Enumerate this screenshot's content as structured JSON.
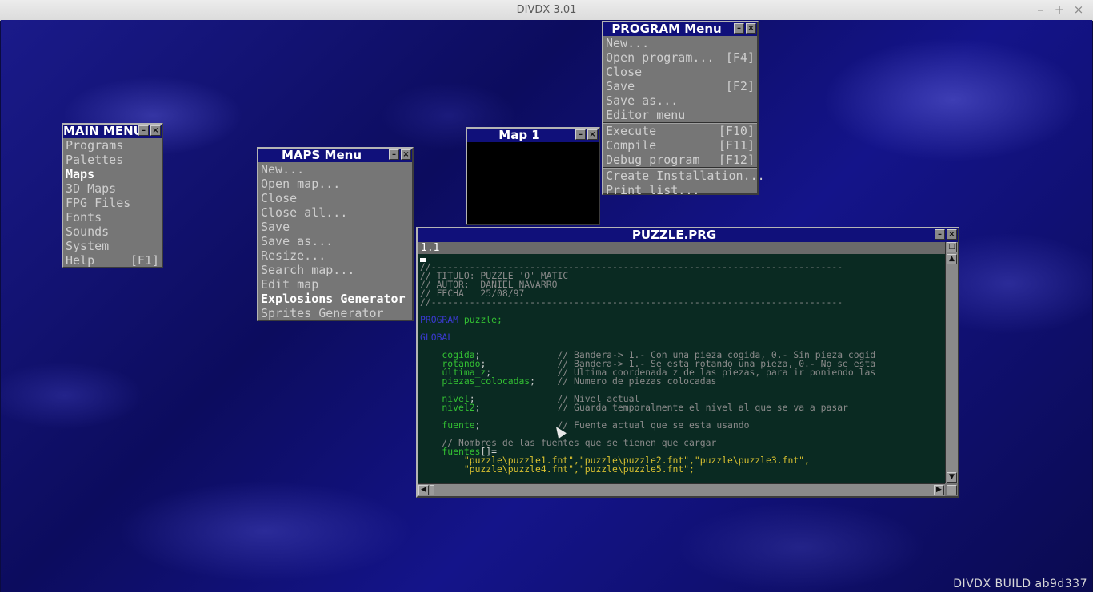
{
  "host": {
    "title": "DIVDX 3.01",
    "minimize": "–",
    "maximize": "+",
    "close": "×"
  },
  "build_label": "DIVDX BUILD ab9d337",
  "main_menu": {
    "title": "MAIN MENU",
    "items": [
      {
        "label": "Programs",
        "shortcut": ""
      },
      {
        "label": "Palettes",
        "shortcut": ""
      },
      {
        "label": "Maps",
        "shortcut": ""
      },
      {
        "label": "3D Maps",
        "shortcut": ""
      },
      {
        "label": "FPG Files",
        "shortcut": ""
      },
      {
        "label": "Fonts",
        "shortcut": ""
      },
      {
        "label": "Sounds",
        "shortcut": ""
      },
      {
        "label": "System",
        "shortcut": ""
      },
      {
        "label": "Help",
        "shortcut": "[F1]"
      }
    ]
  },
  "maps_menu": {
    "title": "MAPS Menu",
    "items": [
      {
        "label": "New..."
      },
      {
        "label": "Open map..."
      },
      {
        "label": "Close"
      },
      {
        "label": "Close all..."
      },
      {
        "label": "Save"
      },
      {
        "label": "Save as..."
      },
      {
        "label": "Resize..."
      },
      {
        "label": "Search map..."
      },
      {
        "label": "Edit map"
      },
      {
        "label": "Explosions Generator"
      },
      {
        "label": "Sprites Generator"
      }
    ]
  },
  "map_window": {
    "title": "Map 1"
  },
  "program_menu": {
    "title": "PROGRAM Menu",
    "items": [
      {
        "label": "New...",
        "shortcut": ""
      },
      {
        "label": "Open program...",
        "shortcut": "[F4]"
      },
      {
        "label": "Close",
        "shortcut": ""
      },
      {
        "label": "Save",
        "shortcut": "[F2]"
      },
      {
        "label": "Save as...",
        "shortcut": ""
      },
      {
        "label": "Editor menu",
        "shortcut": ""
      },
      {
        "label": "Execute",
        "shortcut": "[F10]"
      },
      {
        "label": "Compile",
        "shortcut": "[F11]"
      },
      {
        "label": "Debug program",
        "shortcut": "[F12]"
      },
      {
        "label": "Create Installation...",
        "shortcut": ""
      },
      {
        "label": "Print list...",
        "shortcut": ""
      }
    ]
  },
  "editor": {
    "title": "PUZZLE.PRG",
    "position": "1.1",
    "lines": [
      {
        "t": ""
      },
      {
        "t": "//---------------------------------------------------------------------------",
        "c": "com"
      },
      {
        "t": "// TITULO: PUZZLE 'O' MATIC",
        "c": "com"
      },
      {
        "t": "// AUTOR:  DANIEL NAVARRO",
        "c": "com"
      },
      {
        "t": "// FECHA   25/08/97",
        "c": "com"
      },
      {
        "t": "//---------------------------------------------------------------------------",
        "c": "com"
      },
      {
        "t": ""
      },
      {
        "kw": "PROGRAM",
        "rest": " puzzle;"
      },
      {
        "t": ""
      },
      {
        "kw": "GLOBAL",
        "rest": ""
      },
      {
        "t": ""
      },
      {
        "id": "    cogida",
        "sep": ";              ",
        "com": "// Bandera-> 1.- Con una pieza cogida, 0.- Sin pieza cogid"
      },
      {
        "id": "    rotando",
        "sep": ";             ",
        "com": "// Bandera-> 1.- Se esta rotando una pieza, 0.- No se esta"
      },
      {
        "id": "    última_z",
        "sep": ";            ",
        "com": "// Ultima coordenada z de las piezas, para ir poniendo las"
      },
      {
        "id": "    piezas_colocadas",
        "sep": ";    ",
        "com": "// Numero de piezas colocadas"
      },
      {
        "t": ""
      },
      {
        "id": "    nivel",
        "sep": ";               ",
        "com": "// Nivel actual"
      },
      {
        "id": "    nivel2",
        "sep": ";              ",
        "com": "// Guarda temporalmente el nivel al que se va a pasar"
      },
      {
        "t": ""
      },
      {
        "id": "    fuente",
        "sep": ";              ",
        "com": "// Fuente actual que se esta usando"
      },
      {
        "t": ""
      },
      {
        "t": "    // Nombres de las fuentes que se tienen que cargar",
        "c": "com"
      },
      {
        "id": "    fuentes",
        "sep": "[]=",
        "com": ""
      },
      {
        "str": "        \"puzzle\\puzzle1.fnt\",\"puzzle\\puzzle2.fnt\",\"puzzle\\puzzle3.fnt\","
      },
      {
        "str": "        \"puzzle\\puzzle4.fnt\",\"puzzle\\puzzle5.fnt\";"
      }
    ]
  }
}
